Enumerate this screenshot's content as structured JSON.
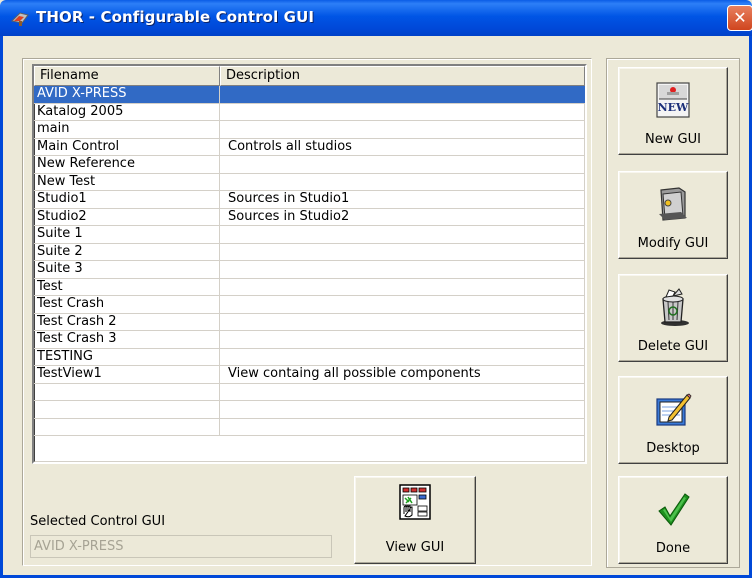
{
  "window": {
    "title": "THOR - Configurable Control GUI",
    "close_symbol": "✕"
  },
  "listview": {
    "columns": [
      "Filename",
      "Description"
    ],
    "rows": [
      {
        "filename": "AVID X-PRESS",
        "description": "",
        "selected": true
      },
      {
        "filename": "Katalog 2005",
        "description": ""
      },
      {
        "filename": "main",
        "description": ""
      },
      {
        "filename": "Main Control",
        "description": "Controls all studios"
      },
      {
        "filename": "New Reference",
        "description": ""
      },
      {
        "filename": "New Test",
        "description": ""
      },
      {
        "filename": "Studio1",
        "description": "Sources in Studio1"
      },
      {
        "filename": "Studio2",
        "description": "Sources in Studio2"
      },
      {
        "filename": "Suite 1",
        "description": ""
      },
      {
        "filename": "Suite 2",
        "description": ""
      },
      {
        "filename": "Suite 3",
        "description": ""
      },
      {
        "filename": "Test",
        "description": ""
      },
      {
        "filename": "Test Crash",
        "description": ""
      },
      {
        "filename": "Test Crash 2",
        "description": ""
      },
      {
        "filename": "Test Crash 3",
        "description": ""
      },
      {
        "filename": "TESTING",
        "description": ""
      },
      {
        "filename": "TestView1",
        "description": "View containg all possible components"
      },
      {
        "filename": "",
        "description": ""
      },
      {
        "filename": "",
        "description": ""
      },
      {
        "filename": "",
        "description": ""
      }
    ]
  },
  "selected": {
    "label": "Selected Control GUI",
    "value": "AVID X-PRESS"
  },
  "buttons": {
    "new_gui": {
      "label": "New GUI",
      "icon": "new-document-icon",
      "icon_text": "NEW"
    },
    "modify_gui": {
      "label": "Modify GUI",
      "icon": "folder-icon"
    },
    "delete_gui": {
      "label": "Delete GUI",
      "icon": "recycle-bin-icon"
    },
    "desktop": {
      "label": "Desktop",
      "icon": "notepad-pencil-icon"
    },
    "done": {
      "label": "Done",
      "icon": "checkmark-icon"
    },
    "view_gui": {
      "label": "View GUI",
      "icon": "view-panel-icon"
    }
  },
  "colors": {
    "title_bar": "#0055e5",
    "selection": "#316ac5",
    "close_button": "#d0451e",
    "done_check": "#1e8f1e"
  }
}
